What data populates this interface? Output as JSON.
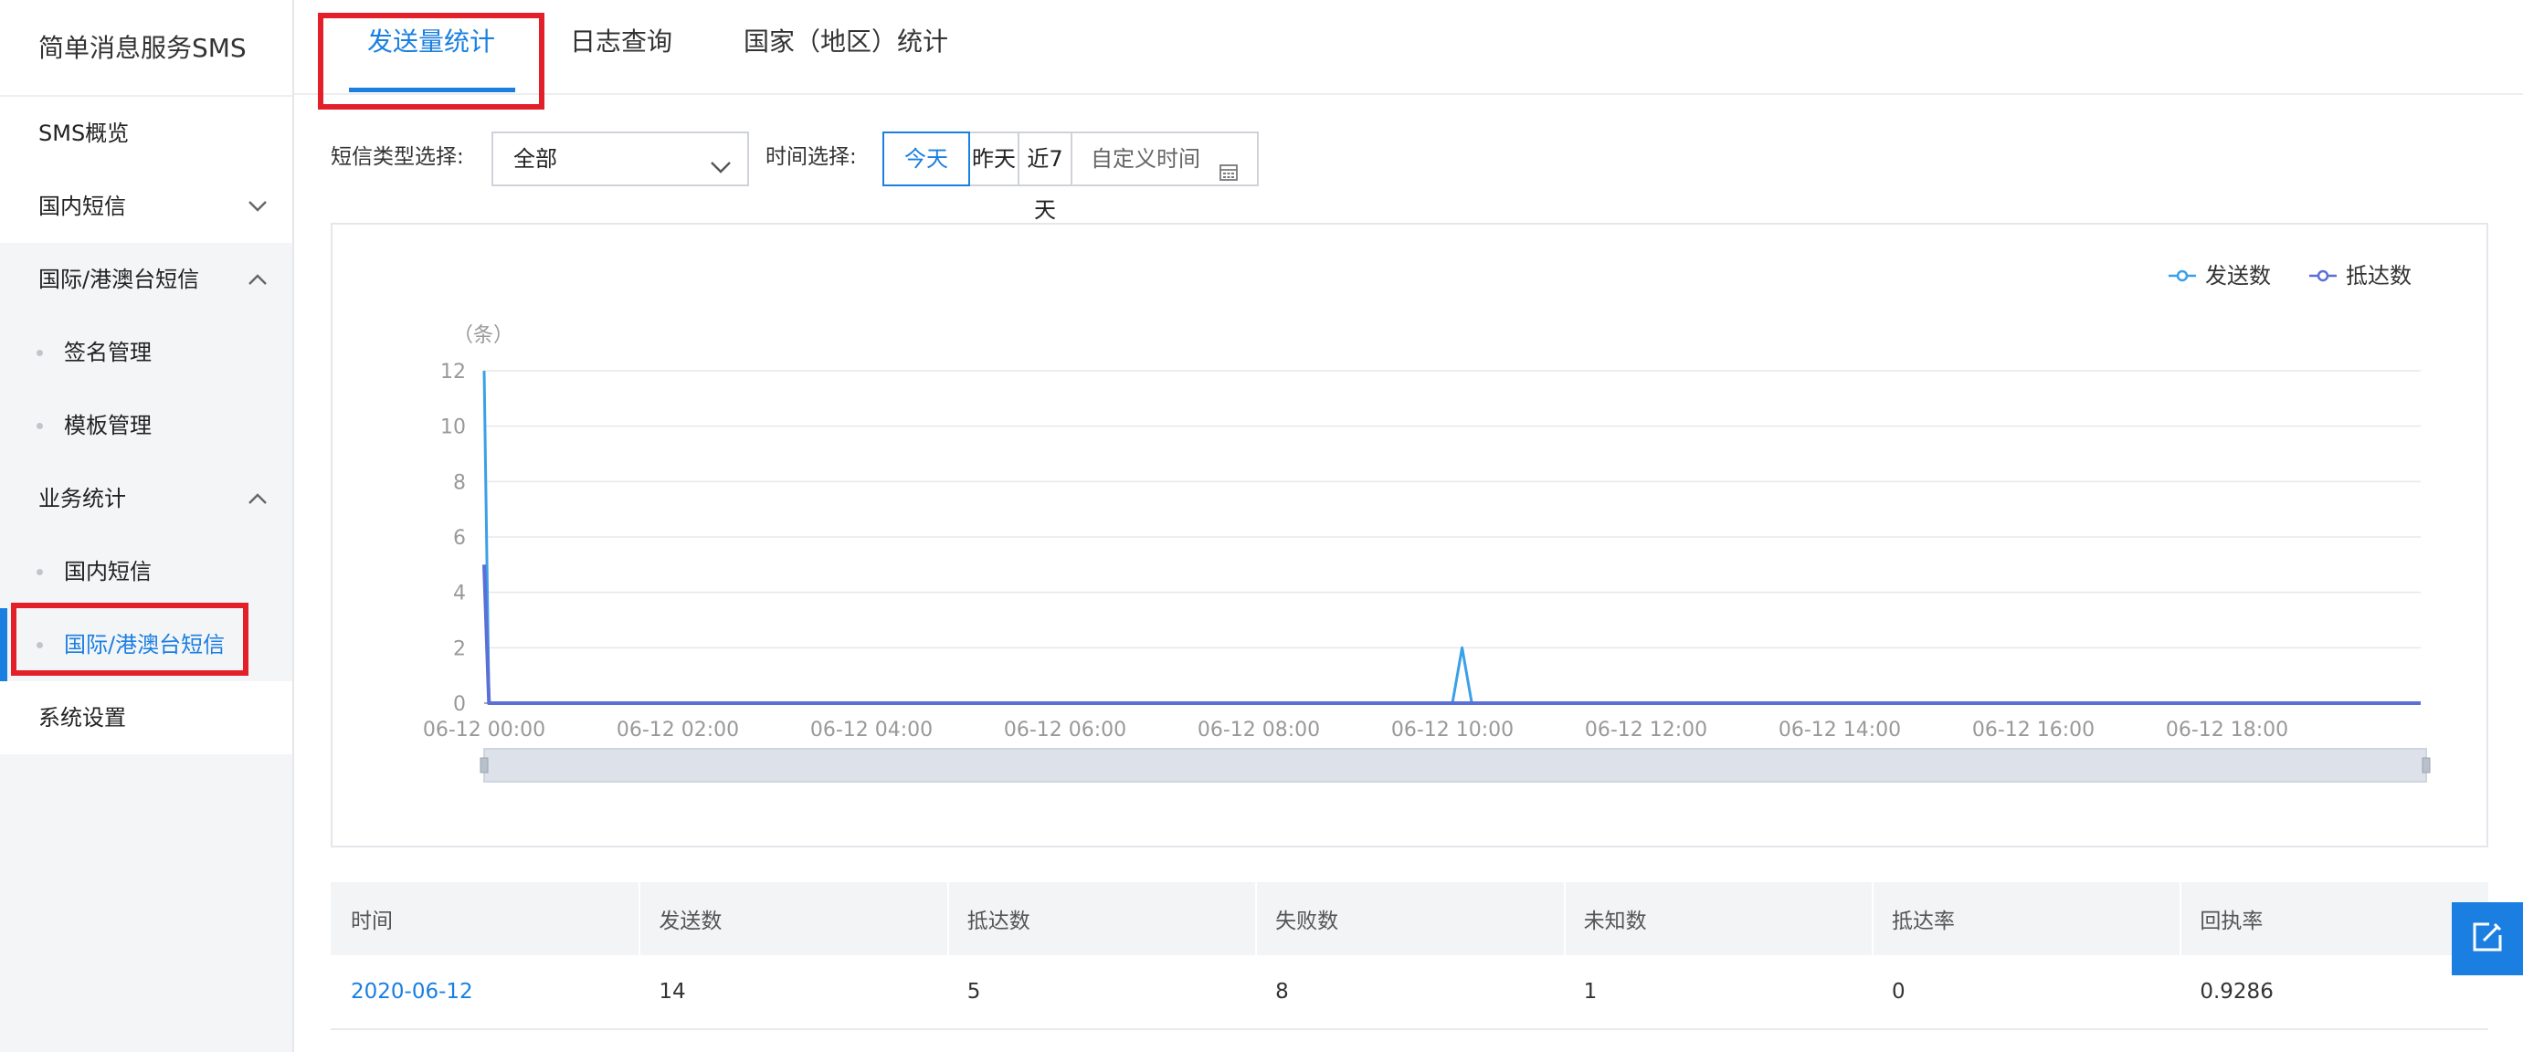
{
  "app": {
    "title": "简单消息服务SMS"
  },
  "sidebar": {
    "items": [
      {
        "label": "SMS概览"
      },
      {
        "label": "国内短信"
      },
      {
        "label": "国际/港澳台短信"
      },
      {
        "label": "签名管理"
      },
      {
        "label": "模板管理"
      },
      {
        "label": "业务统计"
      },
      {
        "label": "国内短信"
      },
      {
        "label": "国际/港澳台短信"
      },
      {
        "label": "系统设置"
      }
    ]
  },
  "tabs": [
    {
      "label": "发送量统计",
      "active": true
    },
    {
      "label": "日志查询"
    },
    {
      "label": "国家（地区）统计"
    }
  ],
  "filters": {
    "type_label": "短信类型选择:",
    "type_value": "全部",
    "time_label": "时间选择:",
    "time_options": [
      "今天",
      "昨天",
      "近7天",
      "自定义时间"
    ],
    "time_selected": "今天"
  },
  "chart_data": {
    "type": "line",
    "ylabel": "（条）",
    "ylim": [
      0,
      12
    ],
    "yticks": [
      0,
      2,
      4,
      6,
      8,
      10,
      12
    ],
    "xticks": [
      "06-12 00:00",
      "06-12 02:00",
      "06-12 04:00",
      "06-12 06:00",
      "06-12 08:00",
      "06-12 10:00",
      "06-12 12:00",
      "06-12 14:00",
      "06-12 16:00",
      "06-12 18:00"
    ],
    "xlim_hours": [
      0,
      20
    ],
    "legend_position": "top-right",
    "grid": true,
    "series": [
      {
        "name": "发送数",
        "color": "#3aa0e8",
        "points": [
          [
            0,
            12
          ],
          [
            0.05,
            0
          ],
          [
            10.0,
            0
          ],
          [
            10.1,
            2
          ],
          [
            10.2,
            0
          ],
          [
            20,
            0
          ]
        ]
      },
      {
        "name": "抵达数",
        "color": "#5b6fd6",
        "points": [
          [
            0,
            5
          ],
          [
            0.05,
            0
          ],
          [
            20,
            0
          ]
        ]
      }
    ]
  },
  "table": {
    "headers": [
      "时间",
      "发送数",
      "抵达数",
      "失败数",
      "未知数",
      "抵达率",
      "回执率"
    ],
    "rows": [
      [
        "2020-06-12",
        "14",
        "5",
        "8",
        "1",
        "0",
        "0.9286"
      ]
    ]
  },
  "colors": {
    "accent": "#1a7fe0",
    "highlight_box": "#e3202a",
    "sidebar_bg": "#f4f5f7"
  }
}
